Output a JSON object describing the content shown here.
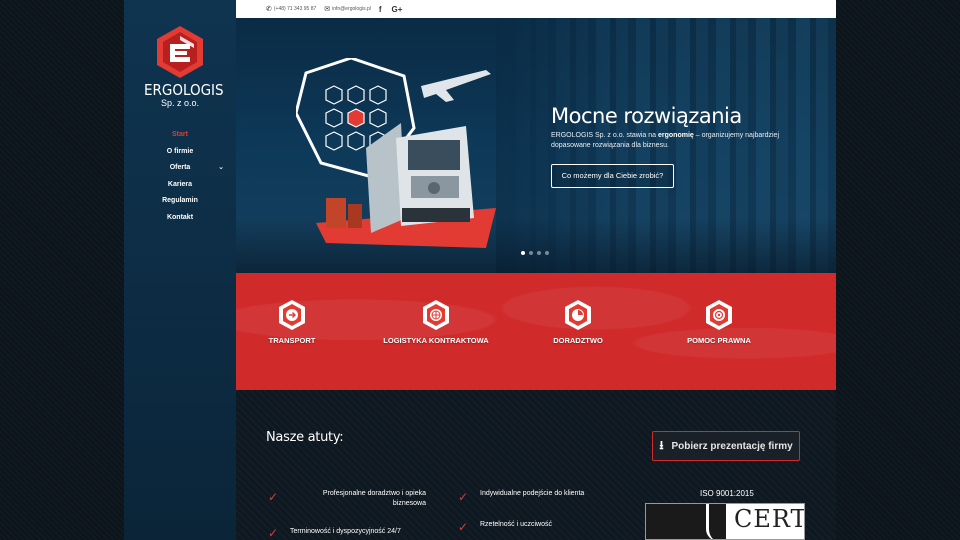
{
  "brand": {
    "name": "ERGOLOGIS",
    "sub": "Sp. z o.o.",
    "accent": "#e23b33",
    "sidebar_color": "#0f3450"
  },
  "nav": {
    "items": [
      {
        "label": "Start",
        "active": true
      },
      {
        "label": "O firmie",
        "active": false
      },
      {
        "label": "Oferta",
        "active": false,
        "has_submenu": true
      },
      {
        "label": "Kariera",
        "active": false
      },
      {
        "label": "Regulamin",
        "active": false
      },
      {
        "label": "Kontakt",
        "active": false
      }
    ]
  },
  "topbar": {
    "phone": "(+48) 71 343 95 87",
    "email": "info@ergologis.pl",
    "phone_icon": "phone-icon",
    "email_icon": "envelope-icon",
    "social": [
      "f",
      "G+"
    ]
  },
  "hero": {
    "title": "Mocne rozwiązania",
    "desc_part1": "ERGOLOGIS Sp. z o.o. stawia na ",
    "desc_bold": "ergonomię",
    "desc_part2": " – organizujemy najbardziej dopasowane rozwiązania dla biznesu.",
    "button": "Co możemy dla Ciebie zrobić?",
    "slides": 4,
    "active_slide": 0
  },
  "services": [
    {
      "label": "TRANSPORT",
      "icon": "truck-icon"
    },
    {
      "label": "LOGISTYKA KONTRAKTOWA",
      "icon": "globe-icon"
    },
    {
      "label": "DORADZTWO",
      "icon": "chart-icon"
    },
    {
      "label": "POMOC PRAWNA",
      "icon": "target-icon"
    }
  ],
  "atuty": {
    "title": "Nasze atuty:",
    "download_button": "Pobierz prezentację firmy",
    "items": [
      "Profesjonalne doradztwo i opieka biznesowa",
      "Indywidualne podejście do klienta",
      "Terminowość i dyspozycyjność 24/7",
      "Rzetelność i uczciwość"
    ]
  },
  "certificate": {
    "label": "ISO 9001:2015",
    "logo_text": "CERT"
  }
}
